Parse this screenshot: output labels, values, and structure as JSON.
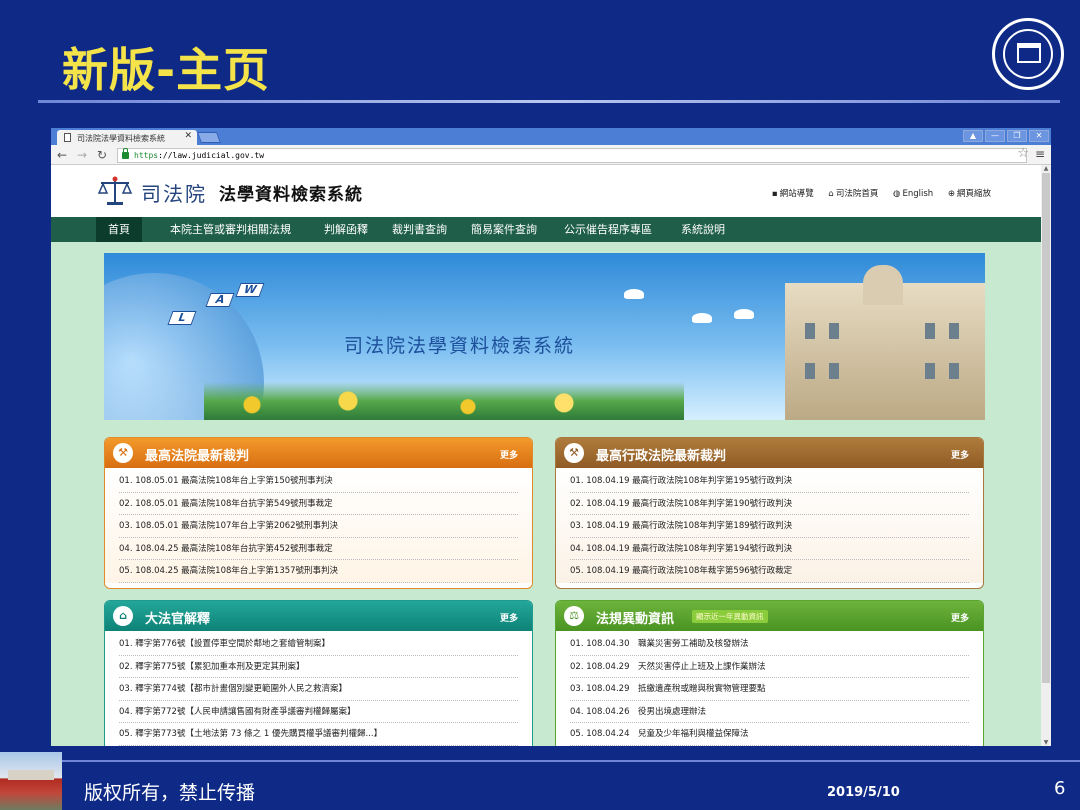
{
  "slide": {
    "title": "新版-主页",
    "footer_text": "版权所有，禁止传播",
    "date": "2019/5/10",
    "page_number": "6"
  },
  "browser": {
    "tab_title": "司法院法學資料檢索系統",
    "url_scheme": "https",
    "url_rest": "://law.judicial.gov.tw",
    "window_controls": [
      "▲",
      "—",
      "❐",
      "✕"
    ]
  },
  "site": {
    "name": "司法院",
    "subtitle": "法學資料檢索系統",
    "top_links": [
      "網站導覽",
      "司法院首頁",
      "English",
      "網頁縮放"
    ],
    "nav": [
      "首頁",
      "本院主管或審判相關法規",
      "判解函釋",
      "裁判書查詢",
      "簡易案件查詢",
      "公示催告程序專區",
      "系統說明"
    ],
    "banner_title": "司法院法學資料檢索系統",
    "banner_tiles": [
      "L",
      "A",
      "W"
    ]
  },
  "panels": {
    "more_label": "更多",
    "supreme_court": {
      "title": "最高法院最新裁判",
      "items": [
        "01. 108.05.01 最高法院108年台上字第150號刑事判決",
        "02. 108.05.01 最高法院108年台抗字第549號刑事裁定",
        "03. 108.05.01 最高法院107年台上字第2062號刑事判決",
        "04. 108.04.25 最高法院108年台抗字第452號刑事裁定",
        "05. 108.04.25 最高法院108年台上字第1357號刑事判決"
      ]
    },
    "admin_court": {
      "title": "最高行政法院最新裁判",
      "items": [
        "01. 108.04.19 最高行政法院108年判字第195號行政判決",
        "02. 108.04.19 最高行政法院108年判字第190號行政判決",
        "03. 108.04.19 最高行政法院108年判字第189號行政判決",
        "04. 108.04.19 最高行政法院108年判字第194號行政判決",
        "05. 108.04.19 最高行政法院108年裁字第596號行政裁定"
      ]
    },
    "interpretations": {
      "title": "大法官解釋",
      "items": [
        "01. 釋字第776號【設置停車空間於鄰地之套繪管制案】",
        "02. 釋字第775號【累犯加重本刑及更定其刑案】",
        "03. 釋字第774號【都市計畫個別變更範圍外人民之救濟案】",
        "04. 釋字第772號【人民申請讓售國有財產爭議審判權歸屬案】",
        "05. 釋字第773號【土地法第 73 條之 1 優先購買權爭議審判權歸...】"
      ]
    },
    "regulations": {
      "title": "法規異動資訊",
      "badge": "顯示近一年異動資訊",
      "items": [
        "01. 108.04.30　職業災害勞工補助及核發辦法",
        "02. 108.04.29　天然災害停止上班及上課作業辦法",
        "03. 108.04.29　抵繳遺產稅或贈與稅實物管理要點",
        "04. 108.04.26　役男出境處理辦法",
        "05. 108.04.24　兒童及少年福利與權益保障法"
      ]
    }
  },
  "colors": {
    "slide_bg": "#0e2a86",
    "slide_title": "#f5e34a",
    "nav_bg": "#1f5f4a",
    "page_bg": "#c6e9cf"
  }
}
